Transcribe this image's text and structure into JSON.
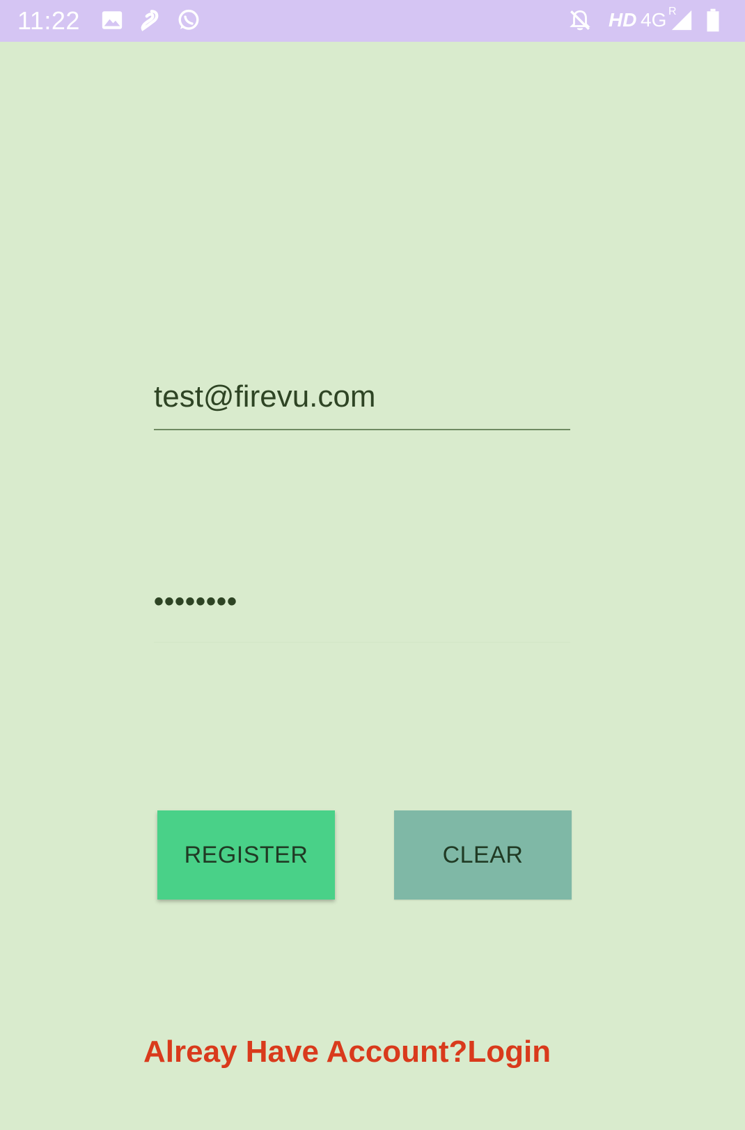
{
  "status_bar": {
    "time": "11:22",
    "hd_label": "HD",
    "network_label": "4G",
    "roaming_label": "R",
    "icons": [
      "gallery-icon",
      "airtel-icon",
      "whatsapp-icon",
      "notifications-off-icon",
      "signal-icon",
      "battery-icon"
    ]
  },
  "form": {
    "email_value": "test@firevu.com",
    "password_value": "••••••••"
  },
  "buttons": {
    "register_label": "REGISTER",
    "clear_label": "CLEAR"
  },
  "login_link": {
    "text": "Alreay Have Account?Login"
  },
  "colors": {
    "background": "#d9ebcd",
    "status_bar": "#d5c5f3",
    "register_button": "#49d188",
    "clear_button": "#7fb8a6",
    "link": "#d93a1c",
    "text": "#2e4424"
  }
}
